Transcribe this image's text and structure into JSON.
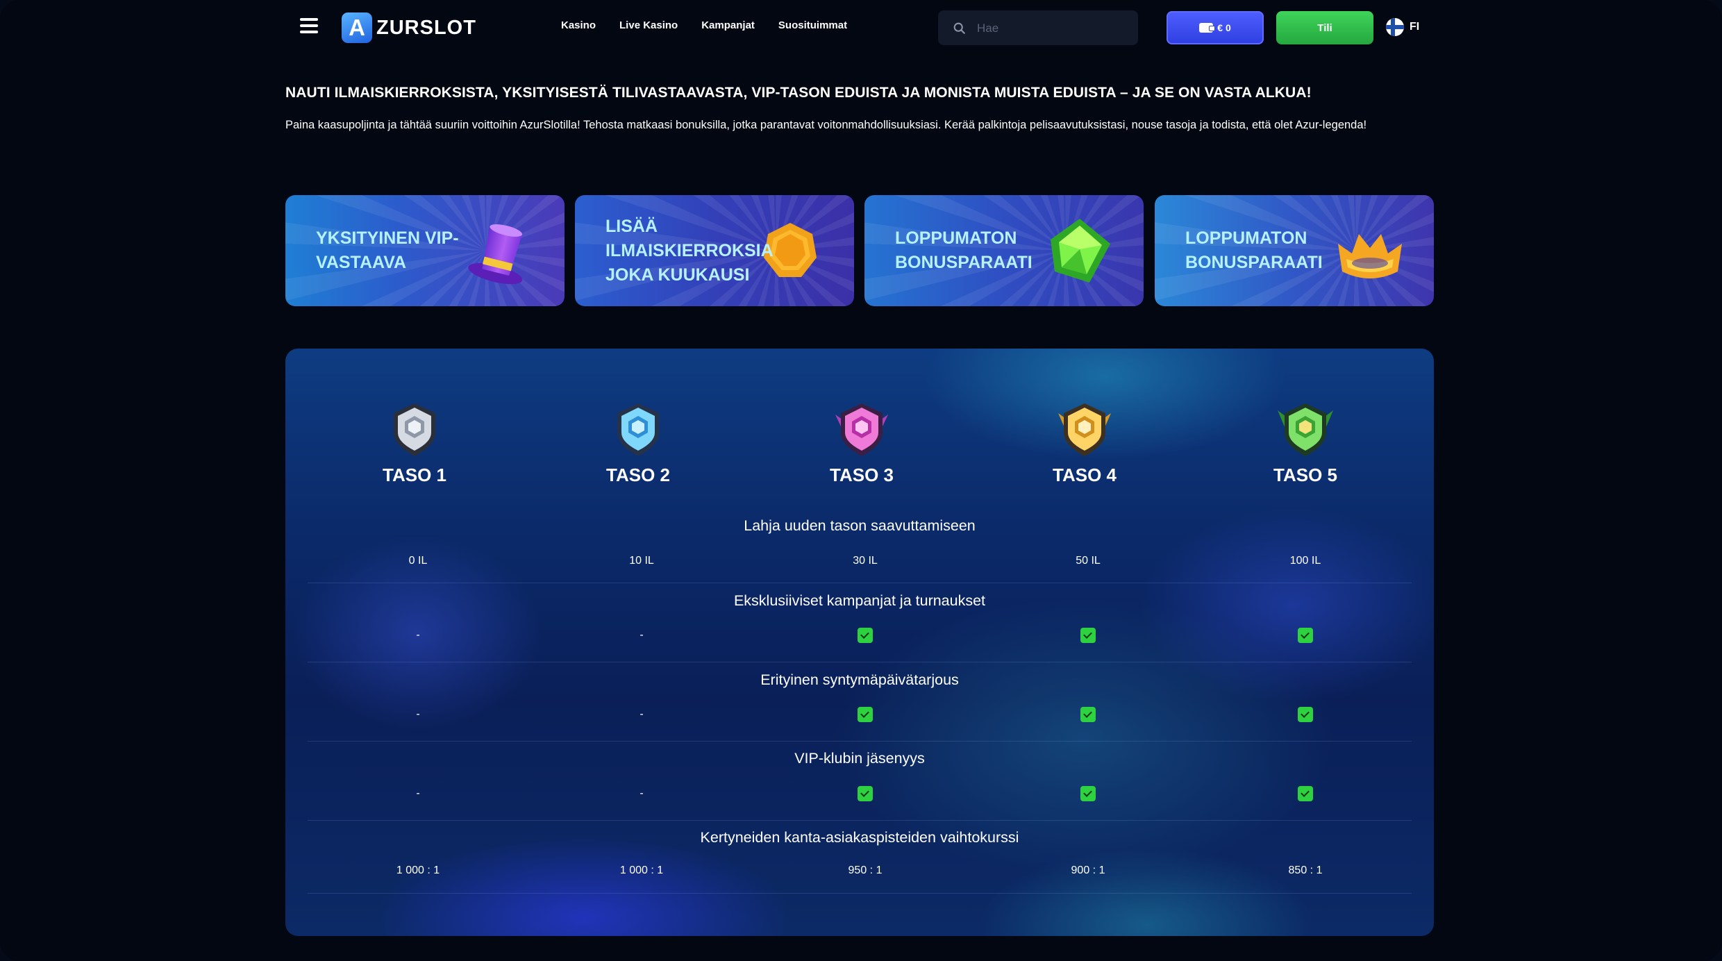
{
  "header": {
    "logo_letter": "A",
    "logo_text": "ZURSLOT",
    "nav": [
      "Kasino",
      "Live Kasino",
      "Kampanjat",
      "Suosituimmat"
    ],
    "search_placeholder": "Hae",
    "wallet_label": "€ 0",
    "account_label": "Tili",
    "language": "FI",
    "colors": {
      "wallet": "#3f4ff0",
      "account": "#30be4c"
    }
  },
  "intro": {
    "headline": "NAUTI ILMAISKIERROKSISTA, YKSITYISESTÄ TILIVASTAAVASTA, VIP-TASON EDUISTA JA MONISTA MUISTA EDUISTA – JA SE ON VASTA ALKUA!",
    "text": "Paina kaasupoljinta ja tähtää suuriin voittoihin AzurSlotilla! Tehosta matkaasi bonuksilla, jotka parantavat voitonmahdollisuuksiasi. Kerää palkintoja pelisaavutuksistasi, nouse tasoja ja todista, että olet Azur-legenda!"
  },
  "cards": [
    {
      "title": "YKSITYINEN VIP-VASTAAVA",
      "icon": "top-hat-icon"
    },
    {
      "title": "LISÄÄ ILMAISKIERROKSIA JOKA KUUKAUSI",
      "icon": "gold-coin-icon"
    },
    {
      "title": "LOPPUMATON BONUSPARAATI",
      "icon": "green-gem-icon"
    },
    {
      "title": "LOPPUMATON BONUSPARAATI",
      "icon": "gold-crown-icon"
    }
  ],
  "levels": {
    "tiers": [
      {
        "name": "TASO 1",
        "color": "#c9cfd8"
      },
      {
        "name": "TASO 2",
        "color": "#5fc7f0"
      },
      {
        "name": "TASO 3",
        "color": "#e04fc4"
      },
      {
        "name": "TASO 4",
        "color": "#f2b935"
      },
      {
        "name": "TASO 5",
        "color": "#4fc24a"
      }
    ],
    "rows": [
      {
        "title": "Lahja uuden tason saavuttamiseen",
        "values": [
          "0 IL",
          "10 IL",
          "30 IL",
          "50 IL",
          "100 IL"
        ]
      },
      {
        "title": "Eksklusiiviset kampanjat ja turnaukset",
        "values": [
          "-",
          "-",
          "check",
          "check",
          "check"
        ]
      },
      {
        "title": "Erityinen syntymäpäivätarjous",
        "values": [
          "-",
          "-",
          "check",
          "check",
          "check"
        ]
      },
      {
        "title": "VIP-klubin jäsenyys",
        "values": [
          "-",
          "-",
          "check",
          "check",
          "check"
        ]
      },
      {
        "title": "Kertyneiden kanta-asiakaspisteiden vaihtokurssi",
        "values": [
          "1 000 : 1",
          "1 000 : 1",
          "950 : 1",
          "900 : 1",
          "850 : 1"
        ]
      }
    ],
    "check_color": "#2ed240"
  }
}
